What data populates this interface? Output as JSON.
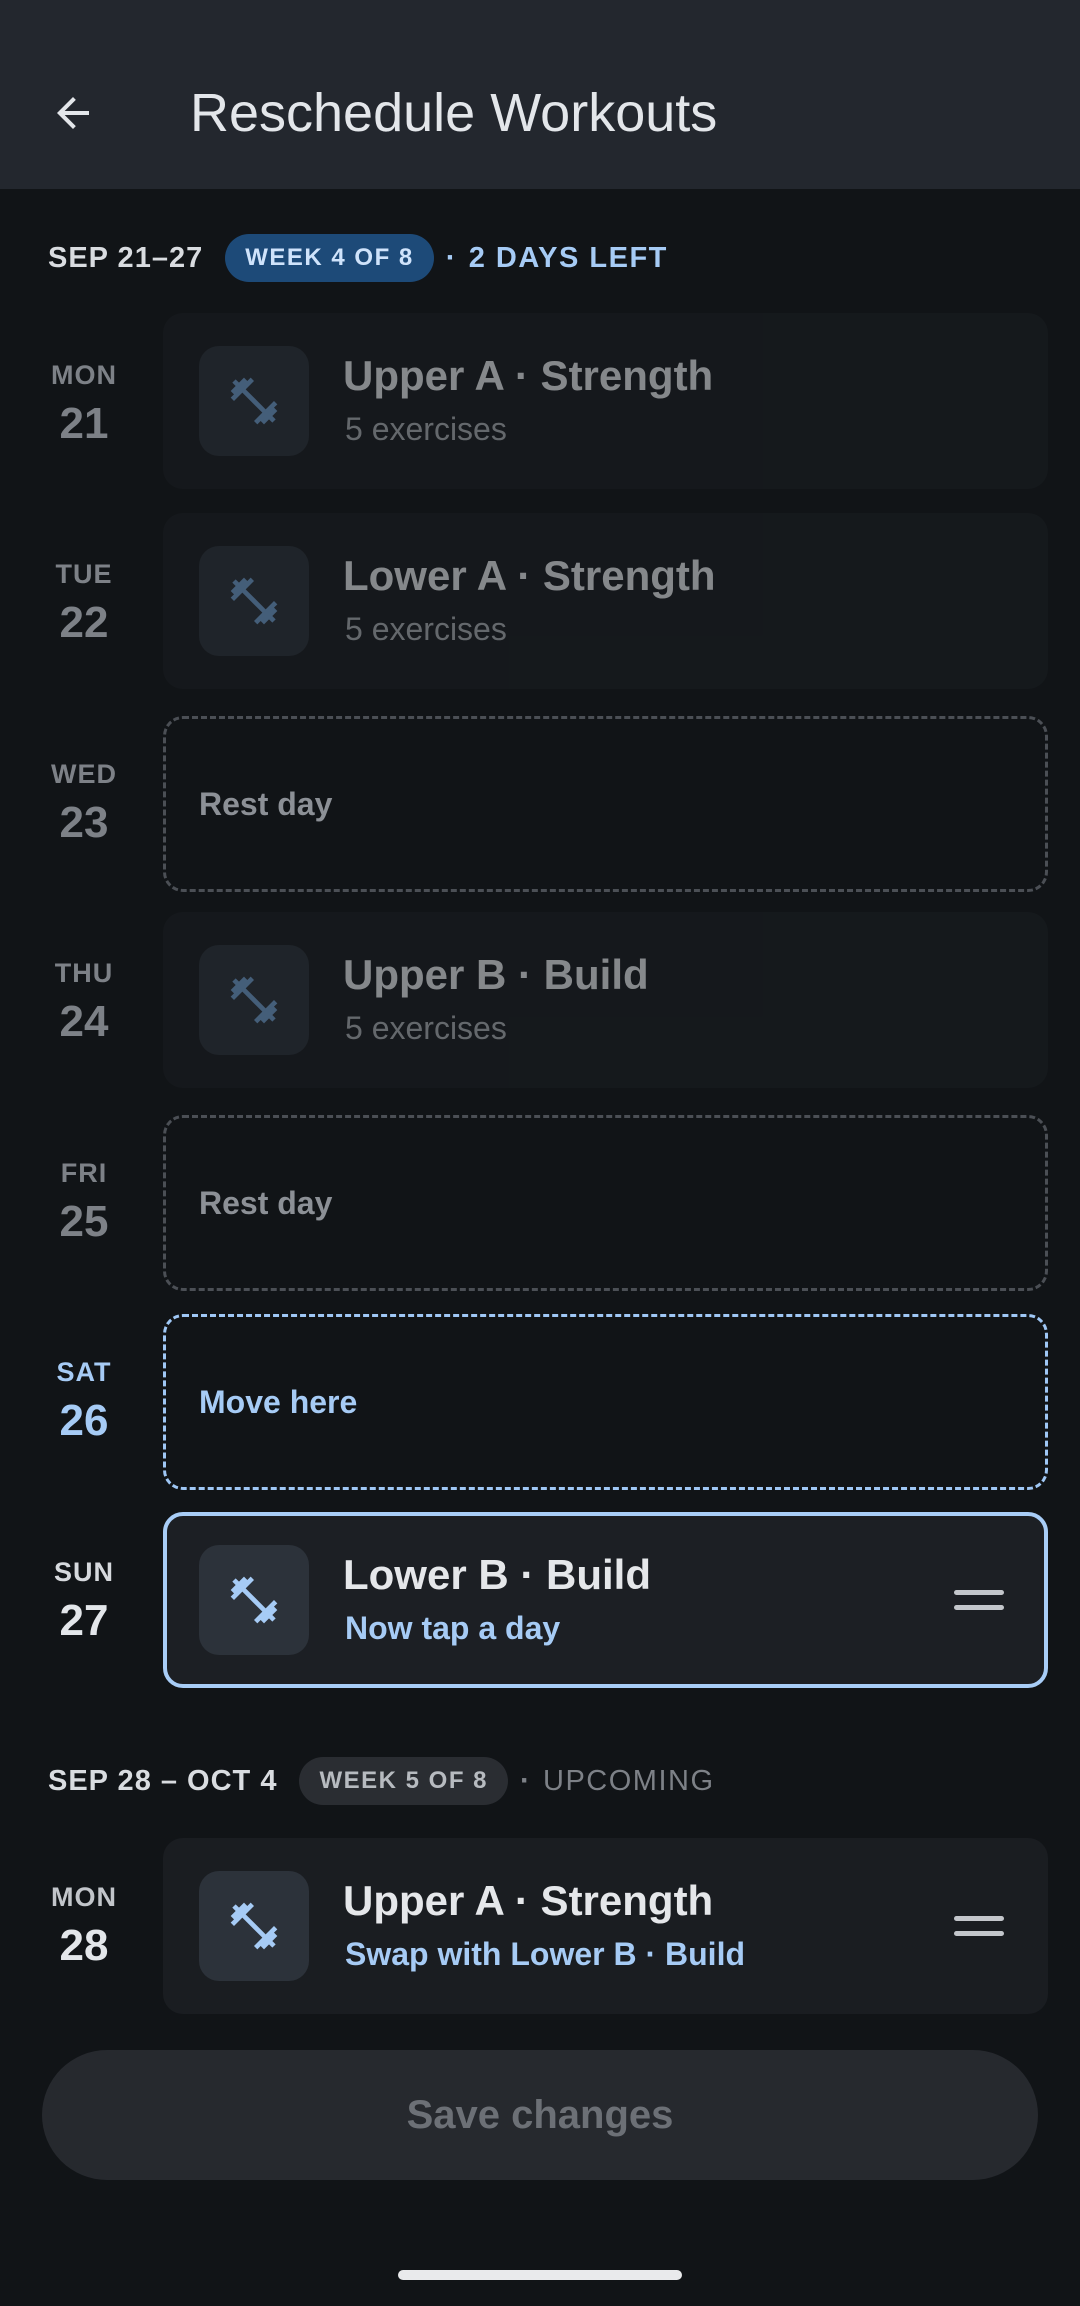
{
  "appbar": {
    "title": "Reschedule Workouts",
    "back_icon": "arrow-left-icon"
  },
  "weeks": [
    {
      "range": "SEP 21–27",
      "chip": "WEEK 4 OF 8",
      "sep": "·",
      "status": "2 DAYS LEFT"
    },
    {
      "range": "SEP 28 – OCT 4",
      "chip": "WEEK 5 OF 8",
      "sep": "·",
      "status": "UPCOMING"
    }
  ],
  "days": [
    {
      "name": "MON",
      "num": "21",
      "kind": "workout",
      "title": "Upper A · Strength",
      "sub": "5 exercises"
    },
    {
      "name": "TUE",
      "num": "22",
      "kind": "workout",
      "title": "Lower A · Strength",
      "sub": "5 exercises"
    },
    {
      "name": "WED",
      "num": "23",
      "kind": "rest",
      "label": "Rest day"
    },
    {
      "name": "THU",
      "num": "24",
      "kind": "workout",
      "title": "Upper B · Build",
      "sub": "5 exercises"
    },
    {
      "name": "FRI",
      "num": "25",
      "kind": "rest",
      "label": "Rest day"
    },
    {
      "name": "SAT",
      "num": "26",
      "kind": "target",
      "label": "Move here"
    },
    {
      "name": "SUN",
      "num": "27",
      "kind": "selected",
      "title": "Lower B · Build",
      "sub": "Now tap a day"
    },
    {
      "name": "MON",
      "num": "28",
      "kind": "swap",
      "title": "Upper A · Strength",
      "sub": "Swap with Lower B · Build"
    }
  ],
  "save_label": "Save changes",
  "colors": {
    "background": "#111417",
    "appbar": "#23272e",
    "accent": "#a6cbf5",
    "chip_active": "#1d4a78",
    "chip_inactive": "#2a2d32"
  },
  "icons": {
    "workout": "dumbbell-icon",
    "drag": "drag-handle-icon"
  }
}
